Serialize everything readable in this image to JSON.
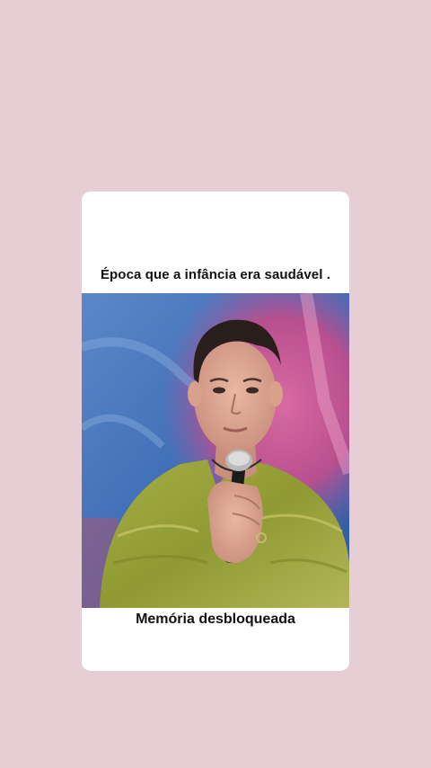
{
  "post": {
    "top_caption": "Época que a infância era saudável .",
    "bottom_caption": "Memória desbloqueada"
  },
  "media": {
    "subject": "man-holding-microphone-photo",
    "background_colors": [
      "#3f6db5",
      "#c94f8d",
      "#8f5ea9"
    ],
    "shirt_color": "#9aa53d"
  },
  "colors": {
    "page_background": "#e7ced5",
    "card_background": "#ffffff",
    "text": "#111111"
  }
}
